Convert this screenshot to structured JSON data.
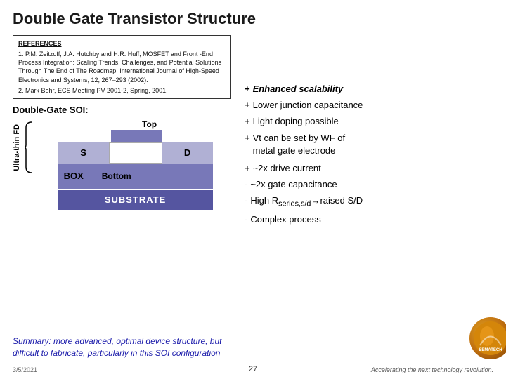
{
  "title": "Double Gate Transistor Structure",
  "references": {
    "heading": "REFERENCES",
    "ref1": "1.  P.M. Zeitzoff, J.A. Hutchby and H.R. Huff, MOSFET and Front -End Process Integration: Scaling Trends, Challenges, and Potential Solutions Through The End of The Roadmap, International Journal of High-Speed Electronics and Systems, 12, 267–293 (2002).",
    "ref2": "2. Mark Bohr, ECS Meeting PV 2001-2, Spring, 2001."
  },
  "diagram": {
    "dg_soi_label": "Double-Gate SOI:",
    "top_label": "Top",
    "s_label": "S",
    "d_label": "D",
    "box_label": "BOX",
    "bottom_label": "Bottom",
    "substrate_label": "SUBSTRATE",
    "ultra_thin_label": "Ultra-thin FD"
  },
  "bullets": [
    {
      "symbol": "+",
      "text": "Enhanced scalability",
      "italic_bold": true
    },
    {
      "symbol": "+",
      "text": "Lower junction capacitance",
      "italic_bold": false
    },
    {
      "symbol": "+",
      "text": "Light doping possible",
      "italic_bold": false
    },
    {
      "symbol": "+",
      "text": "Vt can be set by WF of metal gate electrode",
      "italic_bold": false
    },
    {
      "symbol": "+",
      "text": "~2x drive current",
      "italic_bold": false
    },
    {
      "symbol": "-",
      "text": "~2x gate capacitance",
      "italic_bold": false
    },
    {
      "symbol": "-",
      "text": "High R",
      "subscript": "series,s/d",
      "suffix": "→raised S/D",
      "italic_bold": false
    },
    {
      "symbol": "-",
      "text": "Complex process",
      "italic_bold": false
    }
  ],
  "summary": "Summary:  more advanced, optimal device structure, but difficult to fabricate, particularly in this SOI configuration",
  "page_number": "27",
  "date": "3/5/2021",
  "footer_text": "Accelerating the next technology revolution.",
  "colors": {
    "gate_fill": "#7878b8",
    "box_fill": "#7878b8",
    "substrate_fill": "#5555a0",
    "sd_fill": "#b0b0d4",
    "title_color": "#000000",
    "summary_color": "#2020aa"
  }
}
